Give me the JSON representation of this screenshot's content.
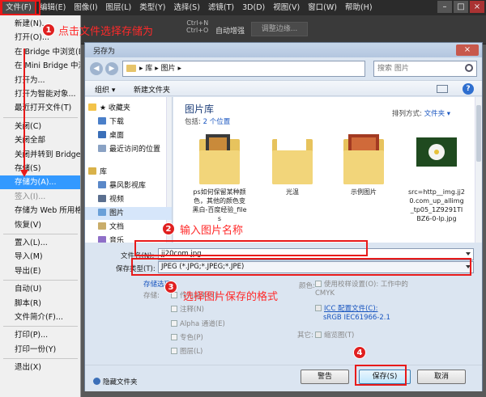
{
  "menubar": {
    "items": [
      "文件(F)",
      "编辑(E)",
      "图像(I)",
      "图层(L)",
      "类型(Y)",
      "选择(S)",
      "滤镜(T)",
      "3D(D)",
      "视图(V)",
      "窗口(W)",
      "帮助(H)"
    ],
    "minimize": "–",
    "maximize": "□",
    "close": "×"
  },
  "options_bar": {
    "shortcut_text_1": "Ctrl+N",
    "shortcut_text_2": "Ctrl+O",
    "auto_enhance": "自动增强",
    "refine_edge": "调整边缘..."
  },
  "file_menu": {
    "items": [
      {
        "label": "新建(N)...",
        "state": "normal"
      },
      {
        "label": "打开(O)...",
        "state": "normal"
      },
      {
        "label": "在 Bridge 中浏览(B)...",
        "state": "normal"
      },
      {
        "label": "在 Mini Bridge 中浏览(G)...",
        "state": "normal"
      },
      {
        "label": "打开为...",
        "state": "normal"
      },
      {
        "label": "打开为智能对象...",
        "state": "normal"
      },
      {
        "label": "最近打开文件(T)",
        "state": "normal"
      },
      {
        "label": "关闭(C)",
        "state": "normal"
      },
      {
        "label": "关闭全部",
        "state": "normal"
      },
      {
        "label": "关闭并转到 Bridge...",
        "state": "normal"
      },
      {
        "label": "存储(S)",
        "state": "normal"
      },
      {
        "label": "存储为(A)...",
        "state": "highlight"
      },
      {
        "label": "签入(I)...",
        "state": "disabled"
      },
      {
        "label": "存储为 Web 所用格式...",
        "state": "normal"
      },
      {
        "label": "恢复(V)",
        "state": "normal"
      },
      {
        "label": "置入(L)...",
        "state": "normal"
      },
      {
        "label": "导入(M)",
        "state": "normal"
      },
      {
        "label": "导出(E)",
        "state": "normal"
      },
      {
        "label": "自动(U)",
        "state": "normal"
      },
      {
        "label": "脚本(R)",
        "state": "normal"
      },
      {
        "label": "文件简介(F)...",
        "state": "normal"
      },
      {
        "label": "打印(P)...",
        "state": "normal"
      },
      {
        "label": "打印一份(Y)",
        "state": "normal"
      },
      {
        "label": "退出(X)",
        "state": "normal"
      }
    ]
  },
  "annotations": {
    "step1_num": "1",
    "step1_text": "点击文件选择存储为",
    "step2_num": "2",
    "step2_text": "输入图片名称",
    "step3_num": "3",
    "step3_text": "选择图片保存的格式",
    "step4_num": "4"
  },
  "dialog": {
    "title": "另存为",
    "close": "×",
    "address": "▸ 库 ▸ 图片 ▸",
    "search_placeholder": "搜索 图片",
    "toolbar": {
      "organize": "组织 ▾",
      "new_folder": "新建文件夹",
      "help": "?"
    },
    "nav": [
      {
        "label": "★ 收藏夹",
        "icon_color": "#f3c34a",
        "selected": false
      },
      {
        "label": "下载",
        "icon_color": "#4a7fc9",
        "selected": false
      },
      {
        "label": "桌面",
        "icon_color": "#3b6fb8",
        "selected": false
      },
      {
        "label": "最近访问的位置",
        "icon_color": "#8aa2c4",
        "selected": false
      },
      {
        "label": "库",
        "icon_color": "#d9b24a",
        "selected": false
      },
      {
        "label": "暴风影视库",
        "icon_color": "#5a88c8",
        "selected": false
      },
      {
        "label": "视频",
        "icon_color": "#5b6f8f",
        "selected": false
      },
      {
        "label": "图片",
        "icon_color": "#6aa0d8",
        "selected": true
      },
      {
        "label": "文档",
        "icon_color": "#c9ad6a",
        "selected": false
      },
      {
        "label": "音乐",
        "icon_color": "#8f6fc8",
        "selected": false
      }
    ],
    "library_title": "图片库",
    "includes_prefix": "包括: ",
    "includes_link": "2 个位置",
    "sort_label": "排列方式:",
    "sort_value": "文件夹 ▾",
    "files": [
      {
        "label": "ps如何保留某种颜色，其他的颜色变黑白-百度经验_files",
        "thumb": "folder-photo"
      },
      {
        "label": "光温",
        "thumb": "folder"
      },
      {
        "label": "示例图片",
        "thumb": "folder-red"
      },
      {
        "label": "src=http__img.jj20.com_up_allimg_tp05_1Z9291TIBZ6-0-lp.jpg",
        "thumb": "flower"
      }
    ],
    "filename_label": "文件名(N):",
    "filename_value": "jj20com.jpg",
    "format_label": "保存类型(T):",
    "format_value": "JPEG (*.JPG;*.JPEG;*.JPE)",
    "save_options": {
      "heading": "存储选项",
      "storage_label": "存储:",
      "as_copy": "作为副本(Y)",
      "annotations": "注释(N)",
      "alpha": "Alpha 通道(E)",
      "spot": "专色(P)",
      "layers": "图层(L)"
    },
    "color": {
      "label": "颜色:",
      "proof": "使用校样设置(O): 工作中的 CMYK",
      "icc": "ICC 配置文件(C):",
      "icc_value": "sRGB IEC61966-2.1"
    },
    "other_label": "其它:",
    "thumbnail": "缩览图(T)",
    "hide_folders": "隐藏文件夹",
    "warning_btn": "警告",
    "save_btn": "保存(S)",
    "cancel_btn": "取消"
  }
}
